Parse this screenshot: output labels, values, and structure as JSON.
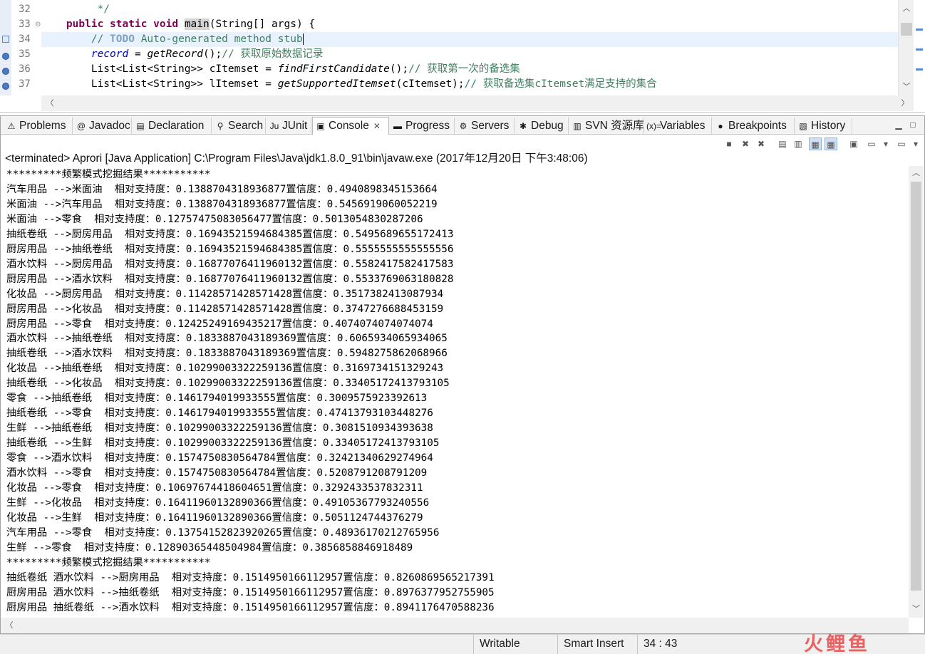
{
  "editor": {
    "lines": [
      {
        "num": "32",
        "tokens": [
          {
            "t": "         */",
            "c": "cm"
          }
        ]
      },
      {
        "num": "33",
        "fold": "⊖",
        "tokens": [
          {
            "t": "    "
          },
          {
            "t": "public",
            "c": "kw"
          },
          {
            "t": " "
          },
          {
            "t": "static",
            "c": "kw"
          },
          {
            "t": " "
          },
          {
            "t": "void",
            "c": "kw"
          },
          {
            "t": " "
          },
          {
            "t": "main",
            "c": "hl"
          },
          {
            "t": "(String[] args) {"
          }
        ]
      },
      {
        "num": "34",
        "current": true,
        "tokens": [
          {
            "t": "        "
          },
          {
            "t": "// ",
            "c": "cm"
          },
          {
            "t": "TODO",
            "c": "todo"
          },
          {
            "t": " Auto-generated method stub",
            "c": "cm"
          }
        ]
      },
      {
        "num": "35",
        "tokens": [
          {
            "t": "        "
          },
          {
            "t": "record",
            "c": "fld"
          },
          {
            "t": " = "
          },
          {
            "t": "getRecord",
            "c": "mth"
          },
          {
            "t": "();"
          },
          {
            "t": "// 获取原始数据记录",
            "c": "cm"
          }
        ]
      },
      {
        "num": "36",
        "tokens": [
          {
            "t": "        List<List<String>> cItemset = "
          },
          {
            "t": "findFirstCandidate",
            "c": "mth"
          },
          {
            "t": "();"
          },
          {
            "t": "// 获取第一次的备选集",
            "c": "cm"
          }
        ]
      },
      {
        "num": "37",
        "tokens": [
          {
            "t": "        List<List<String>> lItemset = "
          },
          {
            "t": "getSupportedItemset",
            "c": "mth"
          },
          {
            "t": "(cItemset);"
          },
          {
            "t": "// 获取备选集cItemset满足支持的集合",
            "c": "cm"
          }
        ]
      }
    ]
  },
  "tabs": [
    {
      "label": "Problems",
      "icon": "problems-icon",
      "glyph": "⚠"
    },
    {
      "label": "Javadoc",
      "icon": "javadoc-icon",
      "glyph": "@"
    },
    {
      "label": "Declaration",
      "icon": "declaration-icon",
      "glyph": "▤"
    },
    {
      "label": "Search",
      "icon": "search-icon",
      "glyph": "⚲"
    },
    {
      "label": "JUnit",
      "icon": "junit-icon",
      "glyph": "Ju"
    },
    {
      "label": "Console",
      "icon": "console-icon",
      "glyph": "▣",
      "active": true
    },
    {
      "label": "Progress",
      "icon": "progress-icon",
      "glyph": "▬"
    },
    {
      "label": "Servers",
      "icon": "servers-icon",
      "glyph": "⚙"
    },
    {
      "label": "Debug",
      "icon": "debug-icon",
      "glyph": "✱"
    },
    {
      "label": "SVN 资源库",
      "icon": "svn-repository-icon",
      "glyph": "▥"
    },
    {
      "label": "Variables",
      "icon": "variables-icon",
      "glyph": "(x)="
    },
    {
      "label": "Breakpoints",
      "icon": "breakpoints-icon",
      "glyph": "●"
    },
    {
      "label": "History",
      "icon": "history-icon",
      "glyph": "▧"
    }
  ],
  "console": {
    "status": "<terminated> Aprori [Java Application] C:\\Program Files\\Java\\jdk1.8.0_91\\bin\\javaw.exe (2017年12月20日 下午3:48:06)",
    "lines": [
      "*********频繁模式挖掘结果***********",
      "汽车用品 -->米面油  相对支持度：0.1388704318936877置信度：0.4940898345153664",
      "米面油 -->汽车用品  相对支持度：0.1388704318936877置信度：0.5456919060052219",
      "米面油 -->零食  相对支持度：0.12757475083056477置信度：0.5013054830287206",
      "抽纸卷纸 -->厨房用品  相对支持度：0.16943521594684385置信度：0.5495689655172413",
      "厨房用品 -->抽纸卷纸  相对支持度：0.16943521594684385置信度：0.5555555555555556",
      "酒水饮料 -->厨房用品  相对支持度：0.16877076411960132置信度：0.5582417582417583",
      "厨房用品 -->酒水饮料  相对支持度：0.16877076411960132置信度：0.5533769063180828",
      "化妆品 -->厨房用品  相对支持度：0.11428571428571428置信度：0.3517382413087934",
      "厨房用品 -->化妆品  相对支持度：0.11428571428571428置信度：0.3747276688453159",
      "厨房用品 -->零食  相对支持度：0.12425249169435217置信度：0.4074074074074074",
      "酒水饮料 -->抽纸卷纸  相对支持度：0.1833887043189369置信度：0.6065934065934065",
      "抽纸卷纸 -->酒水饮料  相对支持度：0.1833887043189369置信度：0.5948275862068966",
      "化妆品 -->抽纸卷纸  相对支持度：0.10299003322259136置信度：0.3169734151329243",
      "抽纸卷纸 -->化妆品  相对支持度：0.10299003322259136置信度：0.33405172413793105",
      "零食 -->抽纸卷纸  相对支持度：0.1461794019933555置信度：0.3009575923392613",
      "抽纸卷纸 -->零食  相对支持度：0.1461794019933555置信度：0.47413793103448276",
      "生鲜 -->抽纸卷纸  相对支持度：0.10299003322259136置信度：0.3081510934393638",
      "抽纸卷纸 -->生鲜  相对支持度：0.10299003322259136置信度：0.33405172413793105",
      "零食 -->酒水饮料  相对支持度：0.1574750830564784置信度：0.32421340629274964",
      "酒水饮料 -->零食  相对支持度：0.1574750830564784置信度：0.5208791208791209",
      "化妆品 -->零食  相对支持度：0.10697674418604651置信度：0.3292433537832311",
      "生鲜 -->化妆品  相对支持度：0.16411960132890366置信度：0.49105367793240556",
      "化妆品 -->生鲜  相对支持度：0.16411960132890366置信度：0.5051124744376279",
      "汽车用品 -->零食  相对支持度：0.13754152823920265置信度：0.48936170212765956",
      "生鲜 -->零食  相对支持度：0.12890365448504984置信度：0.3856858846918489",
      "*********频繁模式挖掘结果***********",
      "抽纸卷纸 酒水饮料 -->厨房用品  相对支持度：0.1514950166112957置信度：0.8260869565217391",
      "厨房用品 酒水饮料 -->抽纸卷纸  相对支持度：0.1514950166112957置信度：0.8976377952755905",
      "厨房用品 抽纸卷纸 -->酒水饮料  相对支持度：0.1514950166112957置信度：0.8941176470588236"
    ]
  },
  "statusbar": {
    "mode": "Writable",
    "insert": "Smart Insert",
    "position": "34 : 43"
  },
  "watermark": "火鲤鱼"
}
